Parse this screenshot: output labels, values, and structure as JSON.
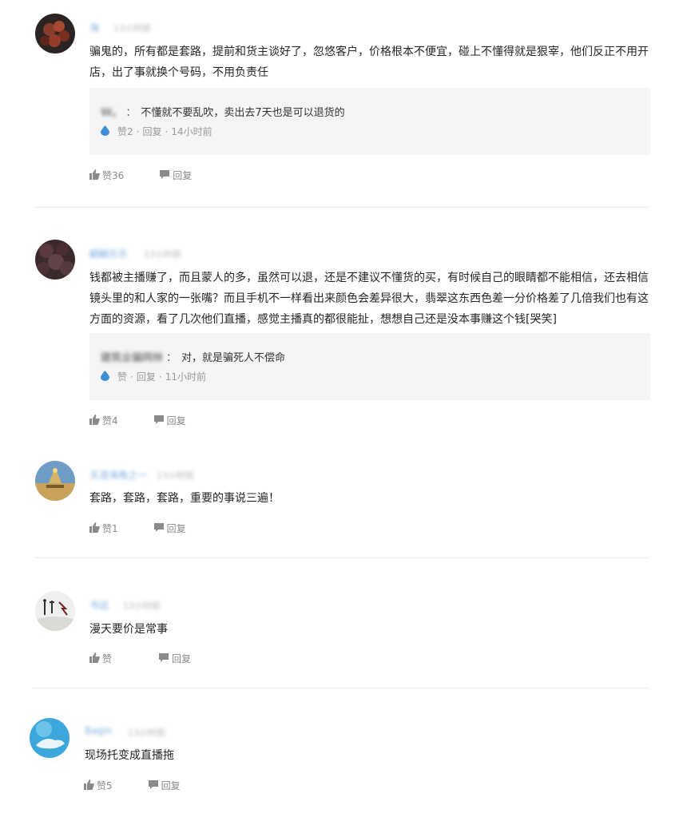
{
  "comments": [
    {
      "user": "海",
      "time": "13小时前",
      "text_lines": [
        "骗鬼的，所有都是套路，提前和货主谈好了，忽悠客户，价格根本不便宜，碰上不懂得就是狠宰，他们反正不用开",
        "店，出了事就换个号码，不用负责任"
      ],
      "reply": {
        "author": "W。",
        "colon": "：",
        "text": "不懂就不要乱吹，卖出去7天也是可以退货的",
        "likes": "赞2",
        "reply_label": "回复",
        "time": "14小时前"
      },
      "like_label": "赞36",
      "reply_label": "回复"
    },
    {
      "user": "翩翩乐乐",
      "time": "13小时前",
      "text_lines": [
        "钱都被主播赚了，而且蒙人的多，虽然可以退，还是不建议不懂货的买，有时候自己的眼睛都不能相信，还去相信",
        "镜头里的和人家的一张嘴？而且手机不一样看出来颜色会差异很大，翡翠这东西色差一分价格差了几倍我们也有这",
        "方面的资源，看了几次他们直播，感觉主播真的都很能扯，想想自己还是没本事赚这个钱[哭笑]"
      ],
      "reply": {
        "author": "建筑业骗网林",
        "colon": "：",
        "text": "对，就是骗死人不偿命",
        "likes": "赞",
        "reply_label": "回复",
        "time": "11小时前"
      },
      "like_label": "赞4",
      "reply_label": "回复"
    },
    {
      "user": "天涯海角之一",
      "time": "13小时前",
      "text_lines": [
        "套路，套路，套路，重要的事说三遍！"
      ],
      "like_label": "赞1",
      "reply_label": "回复"
    },
    {
      "user": "书远",
      "time": "13小时前",
      "text_lines": [
        "漫天要价是常事"
      ],
      "like_label": "赞",
      "reply_label": "回复"
    },
    {
      "user": "Bagin",
      "time": "13小时前",
      "text_lines": [
        "现场托变成直播拖"
      ],
      "like_label": "赞5",
      "reply_label": "回复"
    }
  ],
  "colors": {
    "username": "#7fb0e0",
    "reply_bg": "#f5f5f7",
    "drop_icon": "#3e8fd8",
    "meta_gray": "#8a8a8a"
  }
}
